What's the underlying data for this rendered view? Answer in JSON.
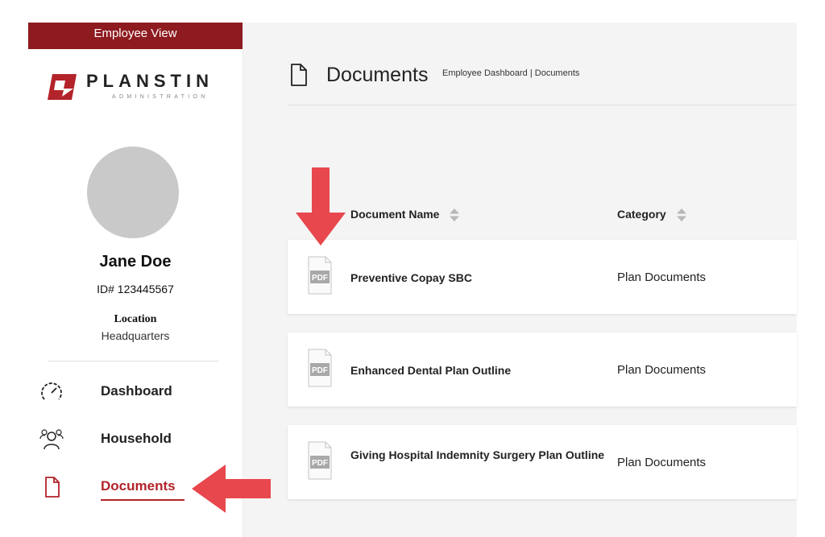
{
  "sidebar": {
    "view_banner": "Employee View",
    "logo": {
      "name": "PLANSTIN",
      "subtitle": "ADMINISTRATION"
    },
    "user": {
      "name": "Jane Doe",
      "id_text": "ID# 123445567",
      "location_label": "Location",
      "location_value": "Headquarters"
    },
    "nav": [
      {
        "label": "Dashboard",
        "icon": "speedometer-icon",
        "active": false
      },
      {
        "label": "Household",
        "icon": "people-icon",
        "active": false
      },
      {
        "label": "Documents",
        "icon": "document-icon",
        "active": true
      }
    ]
  },
  "main": {
    "title": "Documents",
    "breadcrumb": "Employee Dashboard | Documents",
    "columns": [
      "Document Name",
      "Category"
    ],
    "documents": [
      {
        "name": "Preventive Copay SBC",
        "category": "Plan Documents",
        "file_type": "PDF"
      },
      {
        "name": "Enhanced Dental Plan Outline",
        "category": "Plan Documents",
        "file_type": "PDF"
      },
      {
        "name": "Giving Hospital Indemnity Surgery Plan Outline",
        "category": "Plan Documents",
        "file_type": "PDF"
      }
    ]
  },
  "colors": {
    "brand_red": "#8e1b1f",
    "active_red": "#b3232a",
    "annotation_arrow": "#e8474d",
    "avatar_gray": "#c9c9c9"
  }
}
